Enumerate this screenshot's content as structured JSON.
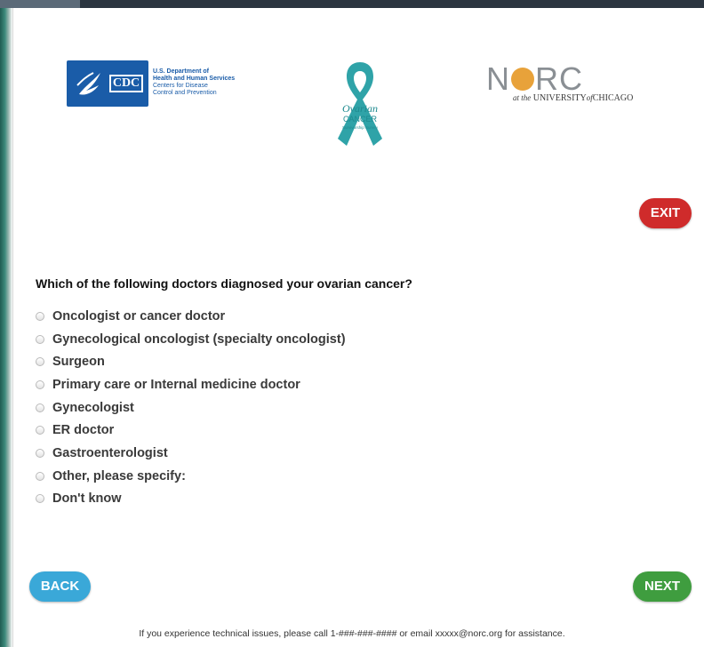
{
  "logos": {
    "cdc": {
      "mark": "CDC",
      "agency_lines": [
        "U.S. Department of",
        "Health and Human Services",
        "Centers for Disease",
        "Control and Prevention"
      ]
    },
    "survey": {
      "line1": "Ovarian",
      "line2": "CANCER",
      "line3": "Survivorship Survey"
    },
    "norc": {
      "word_left": "N",
      "word_right": "RC",
      "sub_prefix": "at the",
      "sub_main": "UNIVERSITY",
      "sub_of": "of",
      "sub_city": "CHICAGO"
    }
  },
  "exit_label": "EXIT",
  "question": "Which of the following doctors diagnosed your ovarian cancer?",
  "options": [
    "Oncologist or cancer doctor",
    "Gynecological oncologist (specialty oncologist)",
    "Surgeon",
    "Primary care or Internal medicine doctor",
    "Gynecologist",
    "ER doctor",
    "Gastroenterologist",
    "Other, please specify:",
    "Don't know"
  ],
  "back_label": "BACK",
  "next_label": "NEXT",
  "footer": "If you experience technical issues, please call 1-###-###-#### or email xxxxx@norc.org for assistance.",
  "colors": {
    "exit": "#cf2b2b",
    "back": "#3aa8d8",
    "next": "#3f9d3f",
    "ribbon": "#2fa3a8",
    "cdc_blue": "#1a5ca8",
    "norc_orange": "#e8a23a"
  }
}
